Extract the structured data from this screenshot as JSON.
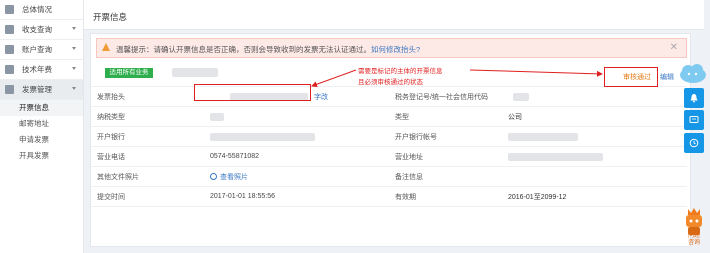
{
  "sidebar": {
    "items": [
      {
        "label": "总体情况"
      },
      {
        "label": "收支查询"
      },
      {
        "label": "账户查询"
      },
      {
        "label": "技术年费"
      },
      {
        "label": "发票管理"
      }
    ],
    "sub_items": [
      {
        "label": "开票信息"
      },
      {
        "label": "邮寄地址"
      },
      {
        "label": "申请发票"
      },
      {
        "label": "开具发票"
      }
    ]
  },
  "header": {
    "title": "开票信息"
  },
  "alert": {
    "text": "温馨提示：请确认开票信息是否正确，否则会导致收到的发票无法认证通过。",
    "link": "如何修改抬头?",
    "close": "✕"
  },
  "badge": "适用所有业务",
  "status": "审核通过",
  "edit": "编辑",
  "annotation": {
    "line1": "需要是标记的主体的开票信息",
    "line2": "且必须审核通过的状态"
  },
  "rows": [
    {
      "k1": "发票抬头",
      "v1": "",
      "v1_tag": "字改",
      "k2": "税务登记号/统一社会信用代码",
      "v2": ""
    },
    {
      "k1": "纳税类型",
      "v1": "",
      "k2": "类型",
      "v2": "公司"
    },
    {
      "k1": "开户银行",
      "v1": "",
      "k2": "开户银行帐号",
      "v2": ""
    },
    {
      "k1": "营业电话",
      "v1": "0574-55871082",
      "k2": "营业地址",
      "v2": ""
    },
    {
      "k1": "其他文件照片",
      "v1": "查看照片",
      "k2": "备注信息",
      "v2": ""
    },
    {
      "k1": "提交时间",
      "v1": "2017-01-01 18:55:56",
      "k2": "有效期",
      "v2": "2016-01至2099-12"
    }
  ],
  "robot_label": "问题\n咨询",
  "colors": {
    "accent": "#1696e6",
    "success": "#2fae4d",
    "warning": "#e67c1a",
    "annotation": "#e02020"
  }
}
